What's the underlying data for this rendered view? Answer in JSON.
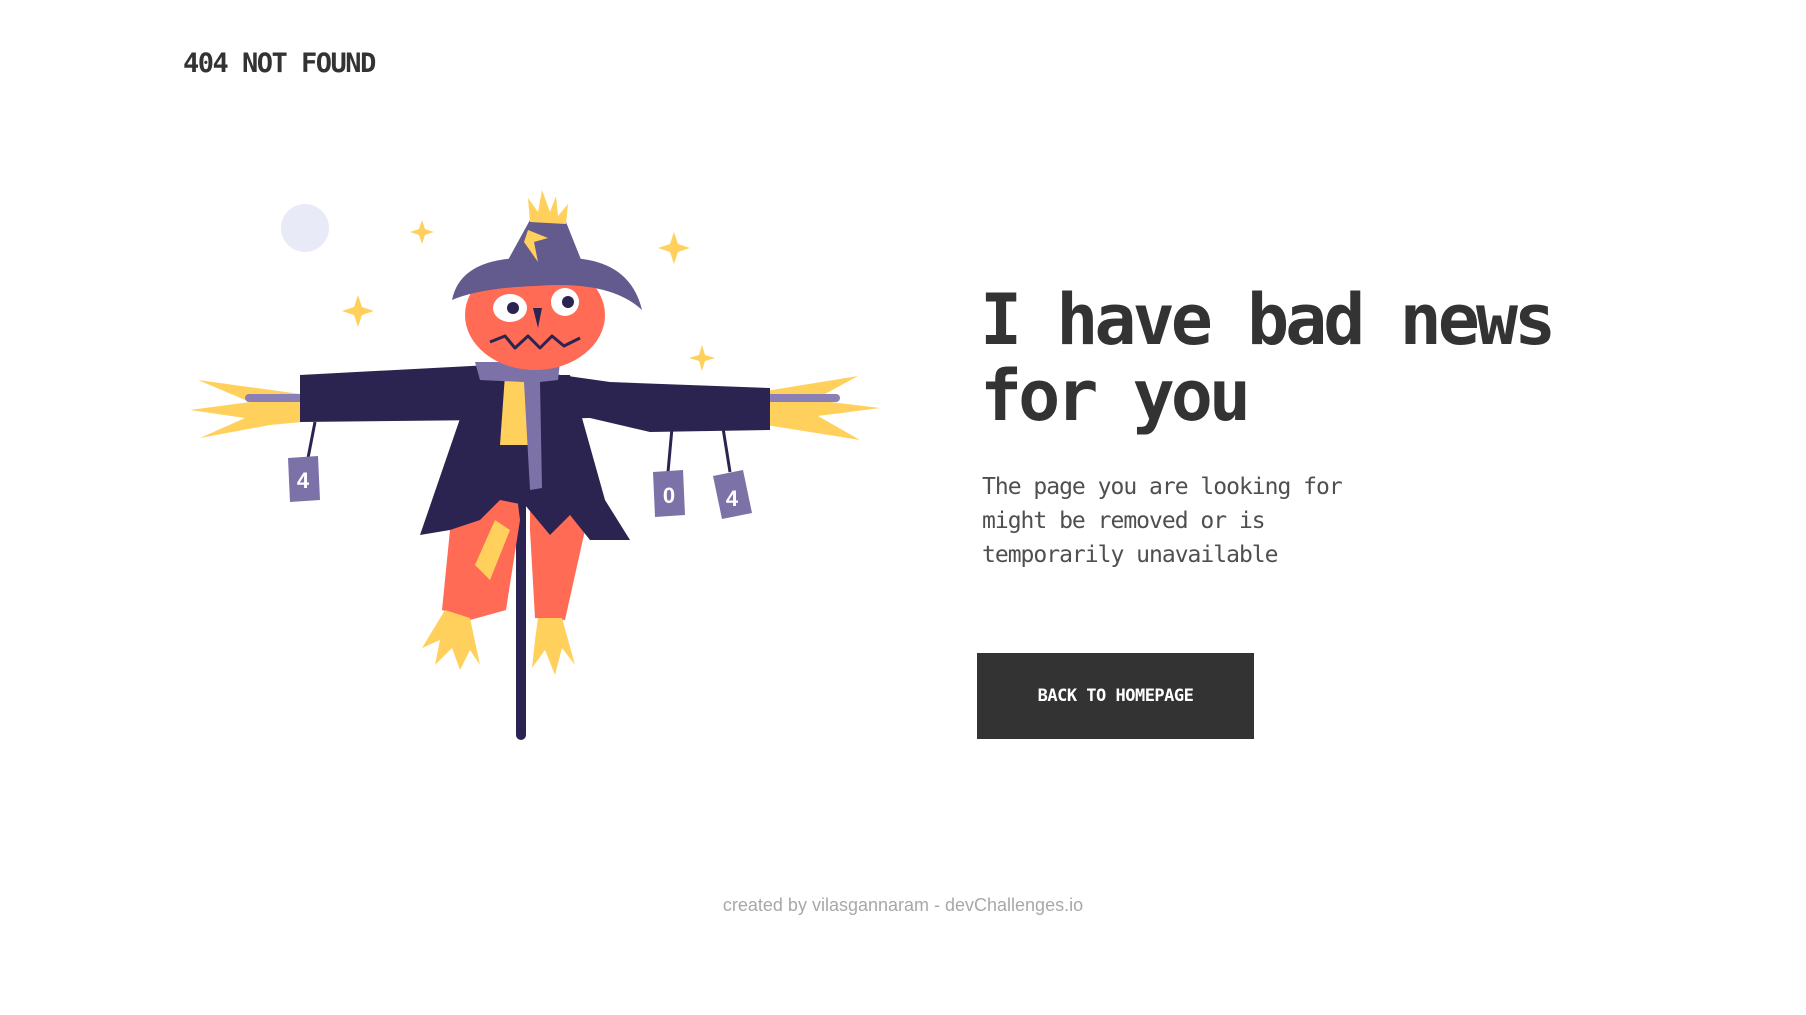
{
  "header": {
    "logo_text": "404 NOT FOUND"
  },
  "illustration": {
    "name": "scarecrow",
    "can_labels": [
      "4",
      "0",
      "4"
    ]
  },
  "main": {
    "headline": "I have bad news for you",
    "message": "The page you are looking for might be removed or is temporarily unavailable",
    "button_label": "BACK TO HOMEPAGE"
  },
  "footer": {
    "credit": "created by vilasgannaram - devChallenges.io"
  },
  "colors": {
    "text": "#333333",
    "button_bg": "#333333",
    "button_text": "#ffffff",
    "footer_text": "#a8a8a8",
    "hat": "#635A8E",
    "coat": "#2B2450",
    "face": "#FF6B55",
    "straw": "#FFD15C",
    "can": "#7C72A8"
  }
}
